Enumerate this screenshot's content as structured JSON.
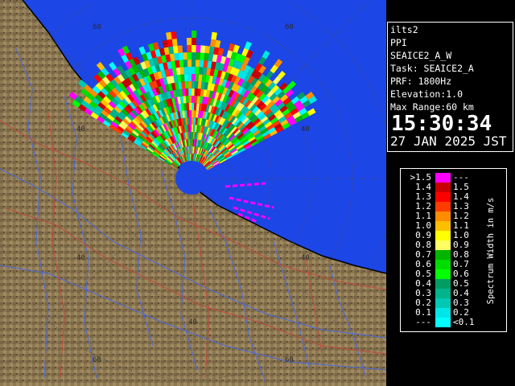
{
  "radar_map": {
    "range_ring_labels": [
      {
        "id": "ring-60-top",
        "text": "60"
      },
      {
        "id": "ring-60-top-right",
        "text": "60"
      },
      {
        "id": "ring-40-left",
        "text": "40"
      },
      {
        "id": "ring-40-right",
        "text": "40"
      },
      {
        "id": "ring-40-lower-left",
        "text": "40"
      },
      {
        "id": "ring-40-bottom",
        "text": "40"
      },
      {
        "id": "ring-40-lower-right",
        "text": "40"
      },
      {
        "id": "ring-60-bottom-left",
        "text": "60"
      },
      {
        "id": "ring-60-bottom-right",
        "text": "60"
      }
    ],
    "colors": {
      "sea": "#1c46e6",
      "land": "#8c7852",
      "river": "#4a6ae0",
      "road": "#c04a3a",
      "ring": "#4a4a4a"
    }
  },
  "info_panel": {
    "station": "ilts2",
    "scan_type": "PPI",
    "product": "SEAICE2_A_W",
    "task": "Task: SEAICE2_A",
    "prf": "PRF: 1800Hz",
    "elevation": "Elevation:1.0",
    "max_range": "Max Range:60 km",
    "time": "15:30:34",
    "date": "27 JAN 2025 JST"
  },
  "legend": {
    "title": "Spectrum Width in m/s",
    "rows": [
      {
        "lo": ">1.5",
        "hi": "---",
        "color": "#ff00ff"
      },
      {
        "lo": "1.4",
        "hi": "1.5",
        "color": "#c80000"
      },
      {
        "lo": "1.3",
        "hi": "1.4",
        "color": "#ff0000"
      },
      {
        "lo": "1.2",
        "hi": "1.3",
        "color": "#ff3c00"
      },
      {
        "lo": "1.1",
        "hi": "1.2",
        "color": "#ff8c00"
      },
      {
        "lo": "1.0",
        "hi": "1.1",
        "color": "#ffbe00"
      },
      {
        "lo": "0.9",
        "hi": "1.0",
        "color": "#ffff00"
      },
      {
        "lo": "0.8",
        "hi": "0.9",
        "color": "#ffff64"
      },
      {
        "lo": "0.7",
        "hi": "0.8",
        "color": "#00b400"
      },
      {
        "lo": "0.6",
        "hi": "0.7",
        "color": "#00dc00"
      },
      {
        "lo": "0.5",
        "hi": "0.6",
        "color": "#00ff00"
      },
      {
        "lo": "0.4",
        "hi": "0.5",
        "color": "#009c64"
      },
      {
        "lo": "0.3",
        "hi": "0.4",
        "color": "#00b48c"
      },
      {
        "lo": "0.2",
        "hi": "0.3",
        "color": "#00c8b4"
      },
      {
        "lo": "0.1",
        "hi": "0.2",
        "color": "#00e6e6"
      },
      {
        "lo": "---",
        "hi": "<0.1",
        "color": "#00ffff"
      }
    ]
  }
}
